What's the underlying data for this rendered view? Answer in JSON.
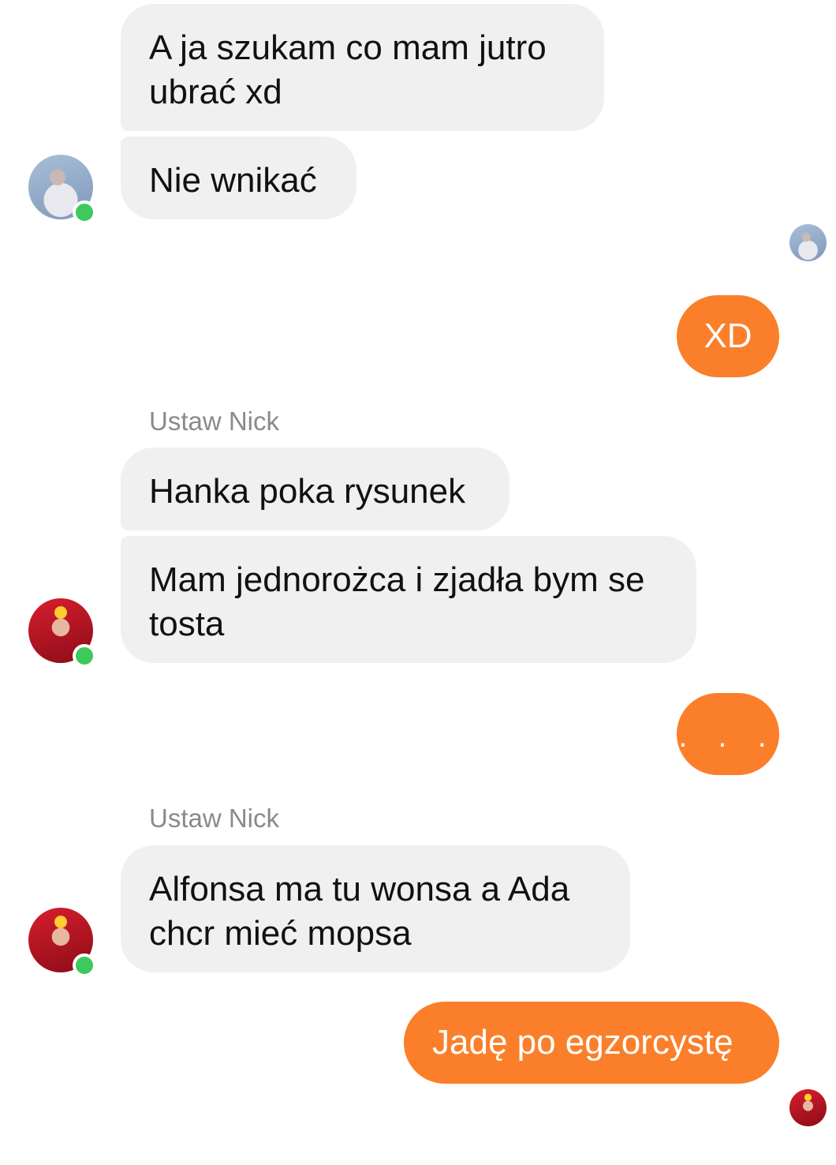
{
  "messages": [
    {
      "direction": "incoming",
      "text": "A ja szukam co mam jutro ubrać xd"
    },
    {
      "direction": "incoming",
      "text": "Nie wnikać"
    },
    {
      "direction": "outgoing",
      "text": "XD"
    },
    {
      "direction": "incoming",
      "sender": "Ustaw Nick",
      "text": "Hanka poka rysunek"
    },
    {
      "direction": "incoming",
      "text": "Mam jednorożca i zjadła bym se tosta"
    },
    {
      "direction": "outgoing",
      "text": ". . ."
    },
    {
      "direction": "incoming",
      "sender": "Ustaw Nick",
      "text": "Alfonsa ma tu wonsa a Ada chcr mieć mopsa"
    },
    {
      "direction": "outgoing",
      "text": "Jadę po egzorcystę"
    }
  ],
  "colors": {
    "incoming_bubble": "#f0f0f0",
    "outgoing_bubble": "#fb7f2a",
    "sender_name": "#8a8a8a",
    "online_dot": "#3ec95c"
  },
  "icons": {
    "avatar_1": "anime-girl-avatar",
    "avatar_2": "red-character-avatar",
    "online": "online-status-dot",
    "read_receipt": "read-receipt-avatar"
  }
}
